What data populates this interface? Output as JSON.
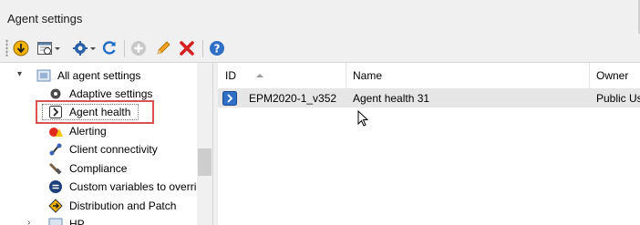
{
  "window": {
    "title": "Agent settings"
  },
  "toolbar": {
    "buttons": [
      {
        "icon": "new-setting-icon"
      },
      {
        "icon": "schedule-icon",
        "dropdown": true
      },
      {
        "icon": "gear-icon",
        "dropdown": true
      },
      {
        "icon": "refresh-icon"
      },
      {
        "icon": "add-icon"
      },
      {
        "icon": "edit-pencil-icon"
      },
      {
        "icon": "delete-x-icon"
      },
      {
        "icon": "help-icon"
      }
    ]
  },
  "tree": {
    "root": {
      "label": "All agent settings",
      "expanded": true
    },
    "items": [
      {
        "label": "Adaptive settings",
        "icon": "adaptive-settings-icon"
      },
      {
        "label": "Agent health",
        "icon": "agent-health-icon",
        "selected": true
      },
      {
        "label": "Alerting",
        "icon": "alerting-icon"
      },
      {
        "label": "Client connectivity",
        "icon": "client-connectivity-icon"
      },
      {
        "label": "Compliance",
        "icon": "compliance-icon"
      },
      {
        "label": "Custom variables to overri",
        "icon": "custom-variables-icon"
      },
      {
        "label": "Distribution and Patch",
        "icon": "distribution-patch-icon"
      },
      {
        "label": "HP",
        "icon": "hp-icon"
      }
    ]
  },
  "grid": {
    "columns": [
      {
        "label": "ID",
        "sorted": "ascending"
      },
      {
        "label": "Name"
      },
      {
        "label": "Owner"
      }
    ],
    "rows": [
      {
        "id": "EPM2020-1_v352",
        "name": "Agent health 31",
        "owner": "Public Us"
      }
    ]
  },
  "colors": {
    "highlight_border": "#d9534f",
    "row_selected_bg": "#e6e6e6",
    "chrome_bg": "#f0f0f0"
  }
}
